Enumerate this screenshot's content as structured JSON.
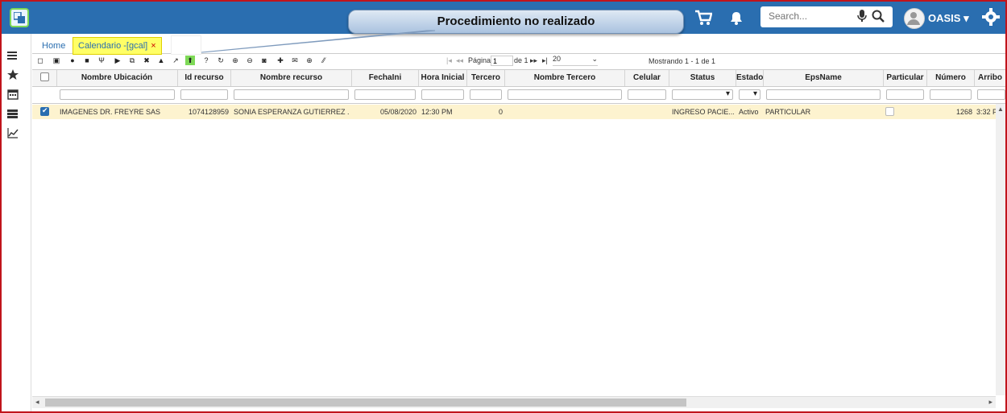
{
  "header": {
    "callout": "Procedimiento no realizado",
    "search_placeholder": "Search...",
    "user_name": "OASIS",
    "user_caret": "▾"
  },
  "tabs": {
    "home": "Home",
    "active": "Calendario -[gcal]",
    "active_close": "×"
  },
  "pager": {
    "page_label": "Página",
    "page_value": "1",
    "of_label": "de 1",
    "page_size": "20",
    "showing": "Mostrando 1 - 1 de 1"
  },
  "grid": {
    "columns": [
      "Nombre Ubicación",
      "Id recurso",
      "Nombre recurso",
      "FechaIni",
      "Hora Inicial",
      "Tercero",
      "Nombre Tercero",
      "Celular",
      "Status",
      "Estado",
      "EpsName",
      "Particular",
      "Número",
      "Arribo"
    ],
    "rows": [
      {
        "nombre_ubicacion": "IMAGENES DR. FREYRE SAS",
        "id_recurso": "1074128959",
        "nombre_recurso": "SONIA ESPERANZA GUTIERREZ ...",
        "fecha_ini": "05/08/2020",
        "hora_inicial": "12:30 PM",
        "tercero": "0",
        "nombre_tercero": "",
        "celular": "",
        "status": "INGRESO PACIE...",
        "estado": "Activo",
        "eps_name": "PARTICULAR",
        "numero": "1268",
        "arribo": "3:32 P"
      }
    ]
  },
  "colors": {
    "topbar": "#2a6eb0",
    "row_highlight": "#fdf3cf",
    "active_tab": "#ffff66",
    "frame": "#c0141c"
  }
}
